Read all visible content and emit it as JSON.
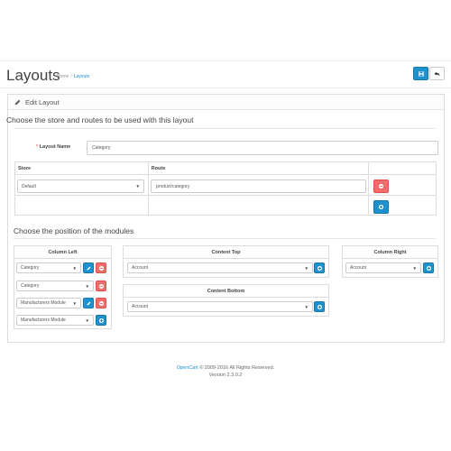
{
  "header": {
    "title": "Layouts",
    "breadcrumb": [
      {
        "label": "Home"
      },
      {
        "label": "Layouts"
      }
    ],
    "save_icon": "save-icon",
    "back_icon": "reply-icon"
  },
  "panel": {
    "heading": "Edit Layout",
    "heading_icon": "pencil-icon",
    "legend_routes": "Choose the store and routes to be used with this layout",
    "layout_name_label": "Layout Name",
    "layout_name_value": "Category",
    "table_headers": [
      "Store",
      "Route",
      ""
    ],
    "route_row": {
      "store": "Default",
      "route": "product/category"
    },
    "legend_modules": "Choose the position of the modules"
  },
  "modules": {
    "column_left": {
      "title": "Column Left",
      "rows": [
        {
          "value": "Category"
        },
        {
          "value": "Category"
        },
        {
          "value": "Manufacturers Module"
        }
      ],
      "add_select": "Manufacturers Module"
    },
    "content_top": {
      "title": "Content Top",
      "add_select": "Account"
    },
    "content_bottom": {
      "title": "Content Bottom",
      "add_select": "Account"
    },
    "column_right": {
      "title": "Column Right",
      "add_select": "Account"
    }
  },
  "footer": {
    "brand": "OpenCart",
    "copyright": "© 2009-2016 All Rights Reserved.",
    "version": "Version 2.3.0.2"
  },
  "colors": {
    "primary": "#1e91cf",
    "danger": "#f56b6b",
    "border": "#dddddd"
  }
}
